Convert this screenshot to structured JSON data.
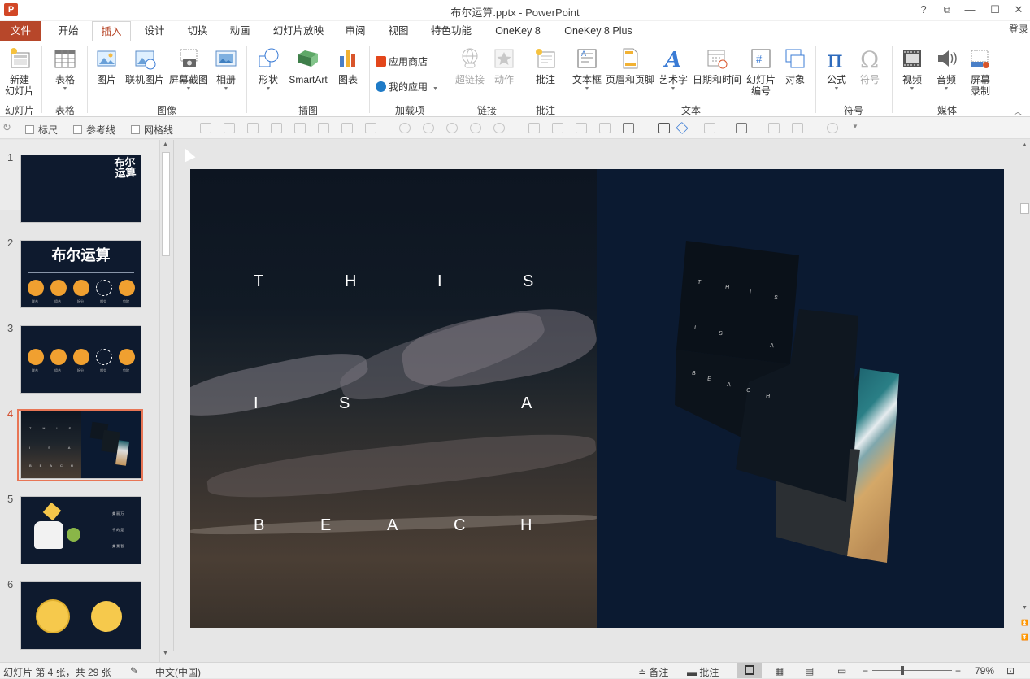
{
  "window": {
    "title": "布尔运算.pptx - PowerPoint",
    "app_icon": "P",
    "controls": [
      "?",
      "⧉",
      "—",
      "☐",
      "✕"
    ]
  },
  "tabs": [
    {
      "label": "文件",
      "id": "file"
    },
    {
      "label": "开始",
      "id": "home"
    },
    {
      "label": "插入",
      "id": "insert",
      "active": true
    },
    {
      "label": "设计",
      "id": "design"
    },
    {
      "label": "切换",
      "id": "transitions"
    },
    {
      "label": "动画",
      "id": "animations"
    },
    {
      "label": "幻灯片放映",
      "id": "slideshow"
    },
    {
      "label": "审阅",
      "id": "review"
    },
    {
      "label": "视图",
      "id": "view"
    },
    {
      "label": "特色功能",
      "id": "features"
    },
    {
      "label": "OneKey 8",
      "id": "onekey8"
    },
    {
      "label": "OneKey 8 Plus",
      "id": "onekey8plus"
    }
  ],
  "login": "登录",
  "ribbon": {
    "groups": [
      "幻灯片",
      "表格",
      "图像",
      "插图",
      "加载项",
      "链接",
      "批注",
      "文本",
      "符号",
      "媒体"
    ],
    "buttons": {
      "new_slide": "新建\n幻灯片",
      "table": "表格",
      "picture": "图片",
      "online_picture": "联机图片",
      "screenshot": "屏幕截图",
      "album": "相册",
      "shapes": "形状",
      "smartart": "SmartArt",
      "chart": "图表",
      "app_store": "应用商店",
      "my_apps": "我的应用",
      "hyperlink": "超链接",
      "action": "动作",
      "comment": "批注",
      "textbox": "文本框",
      "header_footer": "页眉和页脚",
      "wordart": "艺术字",
      "datetime": "日期和时间",
      "slide_number": "幻灯片\n编号",
      "object": "对象",
      "equation": "公式",
      "symbol": "符号",
      "video": "视频",
      "audio": "音频",
      "screen_record": "屏幕\n录制"
    }
  },
  "quickbar": {
    "ruler": "标尺",
    "guides": "参考线",
    "gridlines": "网格线"
  },
  "slides": [
    {
      "num": "1",
      "title_art": "布尔\n运算"
    },
    {
      "num": "2",
      "title_art": "布尔运算",
      "captions": [
        "联合",
        "组合",
        "拆分",
        "相交",
        "剪除"
      ]
    },
    {
      "num": "3",
      "captions": [
        "联合",
        "组合",
        "拆分",
        "相交",
        "剪除"
      ]
    },
    {
      "num": "4",
      "selected": true
    },
    {
      "num": "5",
      "captions": [
        "美 丽 万",
        "千 的 是",
        "美 景 哲"
      ]
    },
    {
      "num": "6"
    }
  ],
  "main_slide": {
    "rows": [
      [
        "T",
        "H",
        "I",
        "S"
      ],
      [
        "I",
        "S",
        "A"
      ],
      [
        "B",
        "E",
        "A",
        "C",
        "H"
      ]
    ],
    "tiny_rows": [
      [
        "T",
        "H",
        "I",
        "S"
      ],
      [
        "I",
        "S",
        "A"
      ],
      [
        "B",
        "E",
        "A",
        "C",
        "H"
      ]
    ],
    "bg_color": "#0b1a31"
  },
  "status": {
    "slide_info": "幻灯片 第 4 张，共 29 张",
    "language": "中文(中国)",
    "notes": "备注",
    "comments": "批注",
    "zoom": "79%",
    "zoom_minus": "−",
    "zoom_plus": "+"
  },
  "colors": {
    "accent": "#b7472a",
    "selection": "#e87555",
    "thumb_bg": "#0e1a2e",
    "orange": "#f0a030"
  }
}
